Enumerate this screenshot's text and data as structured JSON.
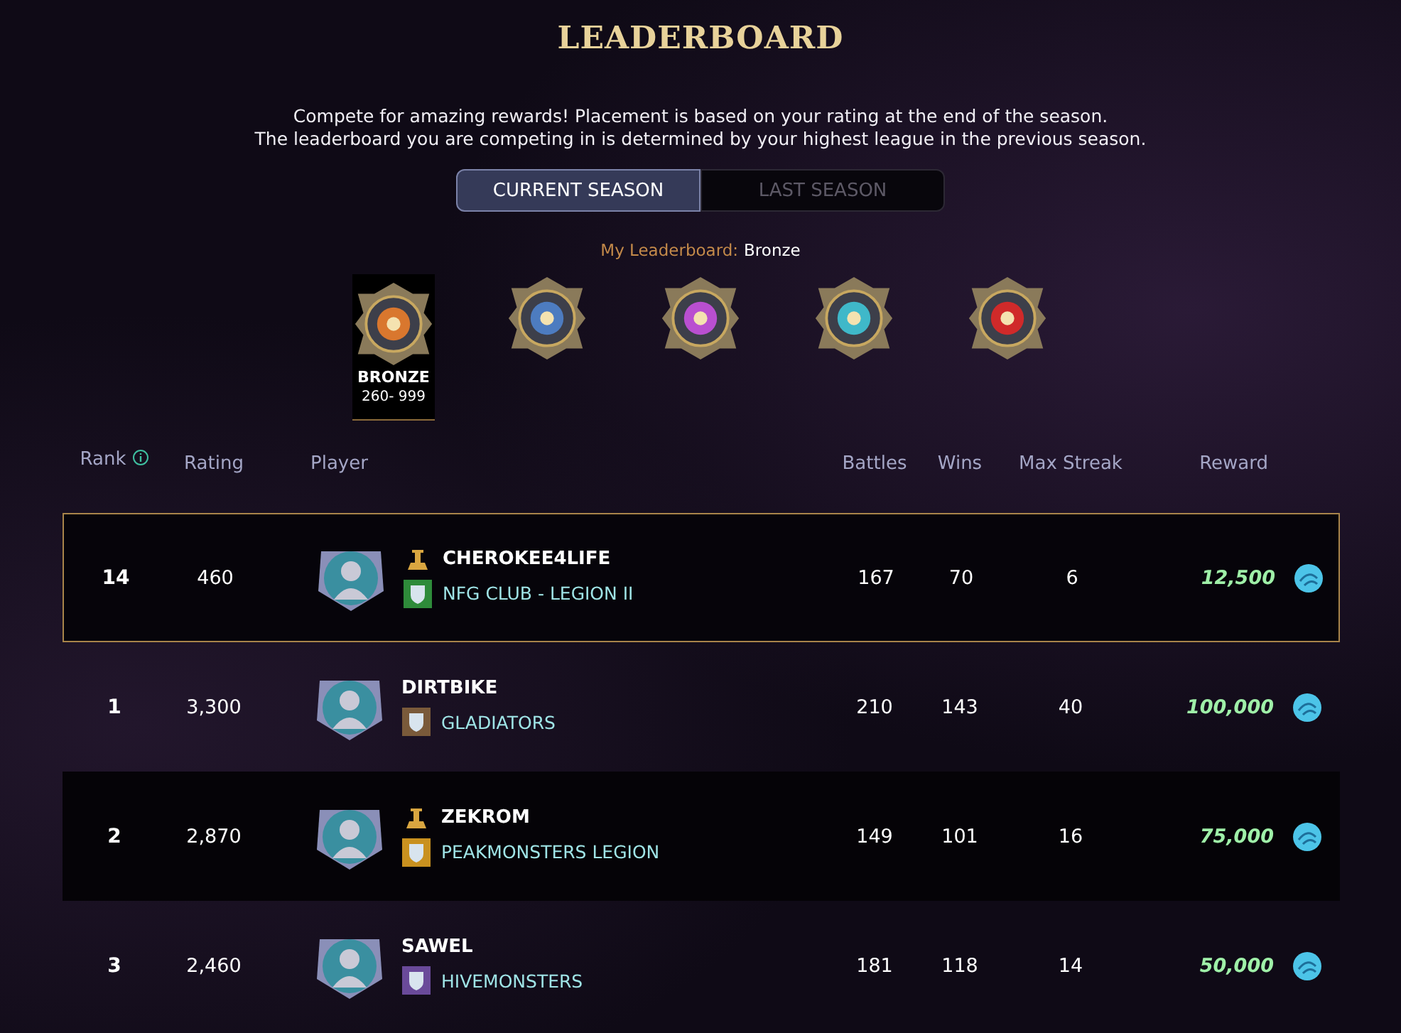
{
  "title": "LEADERBOARD",
  "intro": [
    "Compete for amazing rewards! Placement is based on your rating at the end of the season.",
    "The leaderboard you are competing in is determined by your highest league in the previous season."
  ],
  "tabs": [
    {
      "label": "CURRENT SEASON",
      "selected": true
    },
    {
      "label": "LAST SEASON",
      "selected": false
    }
  ],
  "my_leaderboard": {
    "label": "My Leaderboard:",
    "value": "Bronze"
  },
  "leagues": [
    {
      "selected": true,
      "name": "BRONZE",
      "range": "260- 999",
      "color": "#d9772e"
    },
    {
      "selected": false,
      "color": "#4d7cc0"
    },
    {
      "selected": false,
      "color": "#b94fd0"
    },
    {
      "selected": false,
      "color": "#3fb8c9"
    },
    {
      "selected": false,
      "color": "#d02a2a"
    }
  ],
  "columns": [
    "Rank",
    "Rating",
    "Player",
    "Battles",
    "Wins",
    "Max Streak",
    "Reward"
  ],
  "rows": [
    {
      "own": true,
      "rank": "14",
      "rating": "460",
      "player": "CHEROKEE4LIFE",
      "title_icon": true,
      "guild": {
        "name": "NFG CLUB - LEGION II",
        "color": "#2e8b3a"
      },
      "battles": "167",
      "wins": "70",
      "max_streak": "6",
      "reward": "12,500"
    },
    {
      "own": false,
      "rank": "1",
      "rating": "3,300",
      "player": "DIRTBIKE",
      "title_icon": false,
      "guild": {
        "name": "GLADIATORS",
        "color": "#7a5a3a"
      },
      "battles": "210",
      "wins": "143",
      "max_streak": "40",
      "reward": "100,000"
    },
    {
      "own": false,
      "rank": "2",
      "rating": "2,870",
      "player": "ZEKROM",
      "title_icon": true,
      "guild": {
        "name": "PEAKMONSTERS LEGION",
        "color": "#c9911f"
      },
      "battles": "149",
      "wins": "101",
      "max_streak": "16",
      "reward": "75,000"
    },
    {
      "own": false,
      "rank": "3",
      "rating": "2,460",
      "player": "SAWEL",
      "title_icon": false,
      "guild": {
        "name": "HIVEMONSTERS",
        "color": "#6a4a9a"
      },
      "battles": "181",
      "wins": "118",
      "max_streak": "14",
      "reward": "50,000"
    }
  ]
}
